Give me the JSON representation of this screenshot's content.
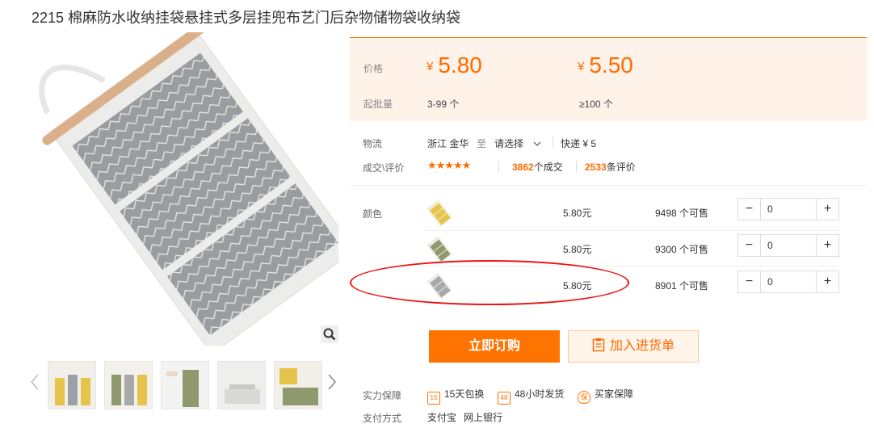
{
  "product": {
    "title": "2215 棉麻防水收纳挂袋悬挂式多层挂兜布艺门后杂物储物袋收纳袋"
  },
  "gallery": {
    "thumb_count": 5
  },
  "pricing": {
    "price_label": "价格",
    "moq_label": "起批量",
    "currency": "¥",
    "tiers": [
      {
        "price": "5.80",
        "qty": "3-99 个"
      },
      {
        "price": "5.50",
        "qty": "≥100 个"
      }
    ]
  },
  "logistics": {
    "label": "物流",
    "origin": "浙江 金华",
    "to": "至",
    "dest_select": "请选择",
    "shipping": "快递 ¥ 5"
  },
  "reviews": {
    "label": "成交\\评价",
    "stars": "★★★★★",
    "deals_count": "3862",
    "deals_suffix": "个成交",
    "review_count": "2533",
    "review_suffix": "条评价"
  },
  "color_label": "颜色",
  "skus": [
    {
      "price": "5.80元",
      "stock": "9498 个可售",
      "qty": "0",
      "color": "#e5c54a"
    },
    {
      "price": "5.80元",
      "stock": "9300 个可售",
      "qty": "0",
      "color": "#8e9a6e"
    },
    {
      "price": "5.80元",
      "stock": "8901 个可售",
      "qty": "0",
      "color": "#a8a8a8"
    }
  ],
  "actions": {
    "buy_label": "立即订购",
    "cart_label": "加入进货单"
  },
  "guarantee": {
    "label": "实力保障",
    "items": [
      {
        "icon": "15",
        "text": "15天包换"
      },
      {
        "icon": "48",
        "text": "48小时发货"
      },
      {
        "icon": "保",
        "text": "买家保障"
      }
    ]
  },
  "payment": {
    "label": "支付方式",
    "methods": [
      "支付宝",
      "网上银行"
    ]
  },
  "colors": {
    "accent": "#ff7300",
    "price": "#ff6a00",
    "annotation": "#e11111"
  }
}
